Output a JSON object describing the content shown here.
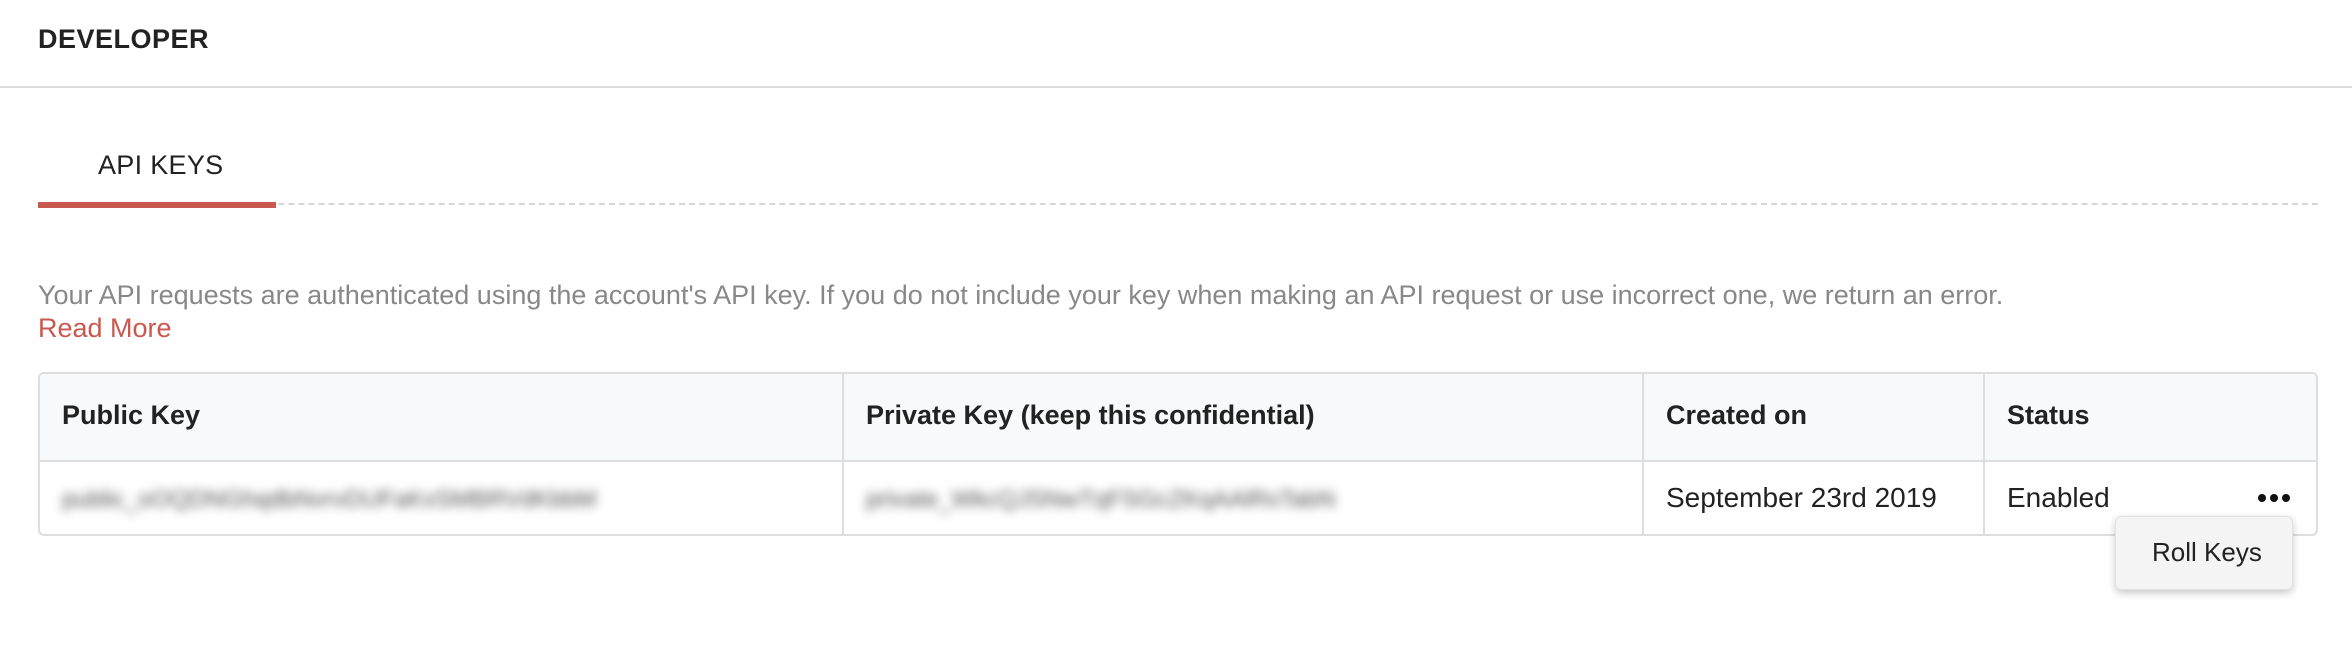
{
  "header": {
    "title": "DEVELOPER"
  },
  "tabs": [
    {
      "label": "API KEYS",
      "active": true
    }
  ],
  "description": {
    "text": "Your API requests are authenticated using the account's API key. If you do not include your key when making an API request or use incorrect one, we return an error.",
    "link_label": "Read More"
  },
  "table": {
    "columns": [
      "Public Key",
      "Private Key (keep this confidential)",
      "Created on",
      "Status"
    ],
    "rows": [
      {
        "public_key": "public_oOQDNGhqdbNvrvDUFaKxSMBRVdKbbM",
        "private_key": "private_WkcQJSNwTqFSGcZKqAAlRsTabN",
        "created_on": "September 23rd 2019",
        "status": "Enabled"
      }
    ]
  },
  "row_menu": {
    "icon": "more-horizontal-icon",
    "items": [
      {
        "label": "Roll Keys"
      }
    ]
  },
  "colors": {
    "accent": "#c9584e",
    "muted_text": "#888888",
    "header_bg": "#f8f9fa",
    "border": "#dedede"
  }
}
